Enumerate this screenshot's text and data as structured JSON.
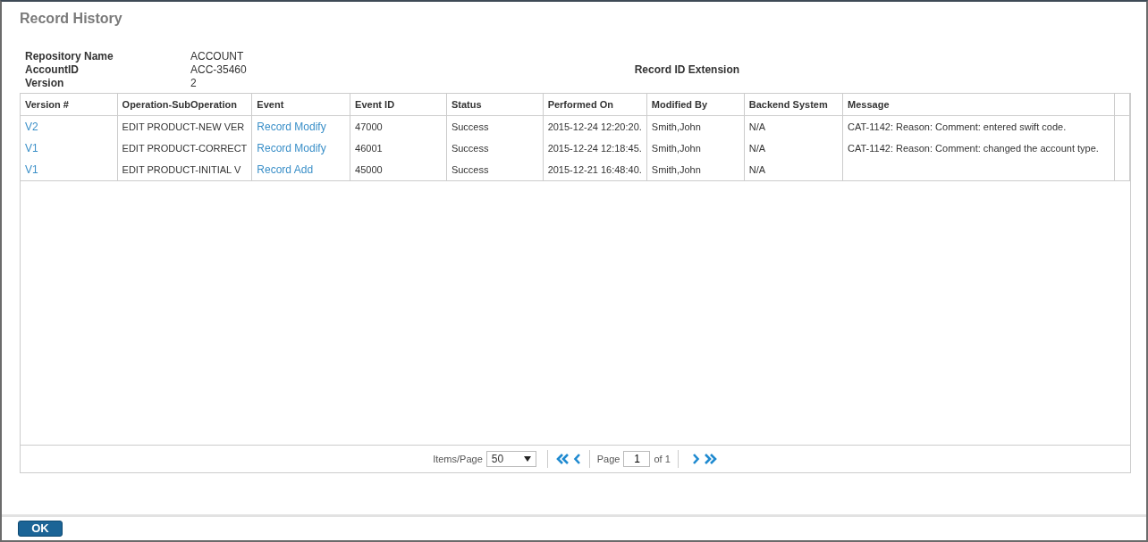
{
  "title": "Record History",
  "info": [
    {
      "label": "Repository Name",
      "value": "ACCOUNT"
    },
    {
      "label": "AccountID",
      "value": "ACC-35460"
    },
    {
      "label": "Version",
      "value": "2"
    }
  ],
  "record_id_extension": {
    "label": "Record ID Extension"
  },
  "table": {
    "columns": [
      "Version #",
      "Operation-SubOperation",
      "Event",
      "Event ID",
      "Status",
      "Performed On",
      "Modified By",
      "Backend System",
      "Message"
    ],
    "rows": [
      [
        "V2",
        "EDIT PRODUCT-NEW VER",
        "Record Modify",
        "47000",
        "Success",
        "2015-12-24 12:20:20.",
        "Smith,John",
        "N/A",
        "CAT-1142: Reason: Comment: entered swift code."
      ],
      [
        "V1",
        "EDIT PRODUCT-CORRECT",
        "Record Modify",
        "46001",
        "Success",
        "2015-12-24 12:18:45.",
        "Smith,John",
        "N/A",
        "CAT-1142: Reason: Comment: changed the account type."
      ],
      [
        "V1",
        "EDIT PRODUCT-INITIAL V",
        "Record Add",
        "45000",
        "Success",
        "2015-12-21 16:48:40.",
        "Smith,John",
        "N/A",
        ""
      ]
    ]
  },
  "pager": {
    "items_label": "Items/Page",
    "items_value": "50",
    "page_label": "Page",
    "page_value": "1",
    "of_label": "of 1"
  },
  "buttons": [
    "OK"
  ]
}
